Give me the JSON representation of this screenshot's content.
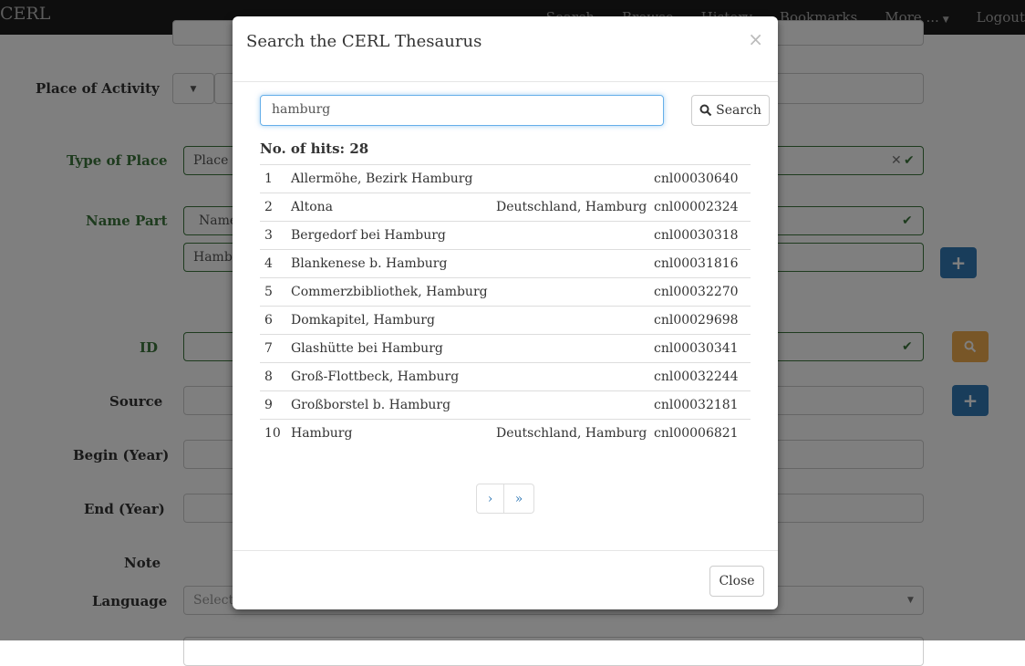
{
  "app": {
    "brand": "CERL"
  },
  "nav": {
    "items": [
      "Search",
      "Browse",
      "History",
      "Bookmarks",
      "More ...",
      "Logout"
    ]
  },
  "form": {
    "place_of_activity_label": "Place of Activity",
    "type_of_place_label": "Type of Place",
    "type_of_place_value": "Place o",
    "name_part_label": "Name Part",
    "name_part_type_value": "Name",
    "name_part_value": "Hambu",
    "id_label": "ID",
    "source_label": "Source",
    "begin_label": "Begin (Year)",
    "end_label": "End (Year)",
    "note_label": "Note",
    "language_label": "Language",
    "language_placeholder": "Select a"
  },
  "modal": {
    "title": "Search the CERL Thesaurus",
    "close_x": "×",
    "search_value": "hamburg",
    "search_button": "Search",
    "hits_label": "No. of hits: 28",
    "results": [
      {
        "n": "1",
        "name": "Allermöhe, Bezirk Hamburg",
        "place": "",
        "id": "cnl00030640"
      },
      {
        "n": "2",
        "name": "Altona",
        "place": "Deutschland, Hamburg",
        "id": "cnl00002324"
      },
      {
        "n": "3",
        "name": "Bergedorf bei Hamburg",
        "place": "",
        "id": "cnl00030318"
      },
      {
        "n": "4",
        "name": "Blankenese b. Hamburg",
        "place": "",
        "id": "cnl00031816"
      },
      {
        "n": "5",
        "name": "Commerzbibliothek, Hamburg",
        "place": "",
        "id": "cnl00032270"
      },
      {
        "n": "6",
        "name": "Domkapitel, Hamburg",
        "place": "",
        "id": "cnl00029698"
      },
      {
        "n": "7",
        "name": "Glashütte bei Hamburg",
        "place": "",
        "id": "cnl00030341"
      },
      {
        "n": "8",
        "name": "Groß-Flottbeck, Hamburg",
        "place": "",
        "id": "cnl00032244"
      },
      {
        "n": "9",
        "name": "Großborstel b. Hamburg",
        "place": "",
        "id": "cnl00032181"
      },
      {
        "n": "10",
        "name": "Hamburg",
        "place": "Deutschland, Hamburg",
        "id": "cnl00006821"
      }
    ],
    "pager_next": "›",
    "pager_last": "»",
    "close_button": "Close"
  },
  "icons": {
    "search": "search-icon",
    "add": "plus-icon",
    "valid": "check-icon",
    "clear": "times-icon",
    "caret": "caret-down-icon"
  },
  "colors": {
    "primary": "#337ab7",
    "warning": "#f0ad4e",
    "success": "#3c763d",
    "navbar": "#1c1c1c"
  }
}
